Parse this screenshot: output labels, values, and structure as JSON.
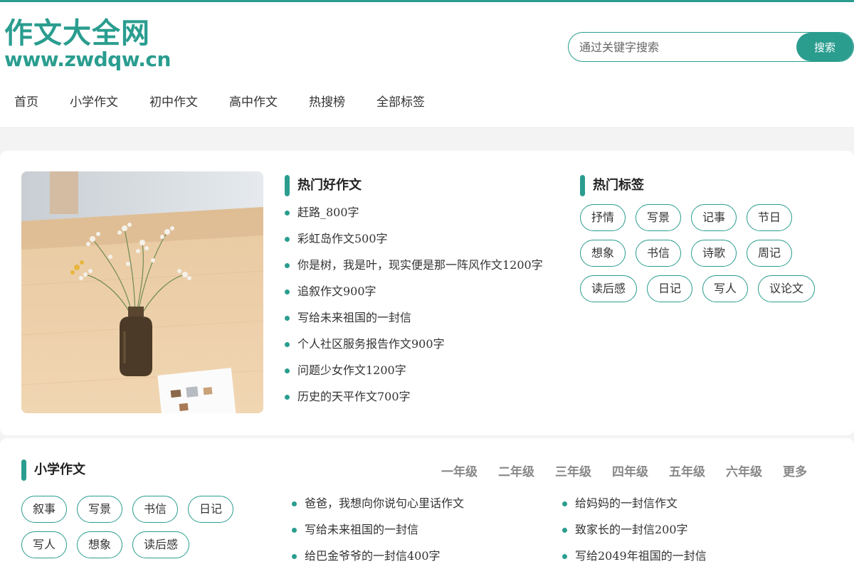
{
  "logo": {
    "cn": "作文大全网",
    "en": "www.zwdqw.cn"
  },
  "search": {
    "placeholder": "通过关键字搜索",
    "button": "搜索"
  },
  "nav": [
    "首页",
    "小学作文",
    "初中作文",
    "高中作文",
    "热搜榜",
    "全部标签"
  ],
  "hot_essays": {
    "title": "热门好作文",
    "items": [
      "赶路_800字",
      "彩虹岛作文500字",
      "你是树，我是叶，现实便是那一阵风作文1200字",
      "追叙作文900字",
      "写给未来祖国的一封信",
      "个人社区服务报告作文900字",
      "问题少女作文1200字",
      "历史的天平作文700字"
    ]
  },
  "hot_tags": {
    "title": "热门标签",
    "items": [
      "抒情",
      "写景",
      "记事",
      "节日",
      "想象",
      "书信",
      "诗歌",
      "周记",
      "读后感",
      "日记",
      "写人",
      "议论文"
    ]
  },
  "primary": {
    "title": "小学作文",
    "grades": [
      "一年级",
      "二年级",
      "三年级",
      "四年级",
      "五年级",
      "六年级",
      "更多"
    ],
    "tags": [
      "叙事",
      "写景",
      "书信",
      "日记",
      "写人",
      "想象",
      "读后感"
    ],
    "col1": [
      "爸爸，我想向你说句心里话作文",
      "写给未来祖国的一封信",
      "给巴金爷爷的一封信400字"
    ],
    "col2": [
      "给妈妈的一封信作文",
      "致家长的一封信200字",
      "写给2049年祖国的一封信"
    ]
  },
  "colors": {
    "accent": "#2a9d8f"
  }
}
